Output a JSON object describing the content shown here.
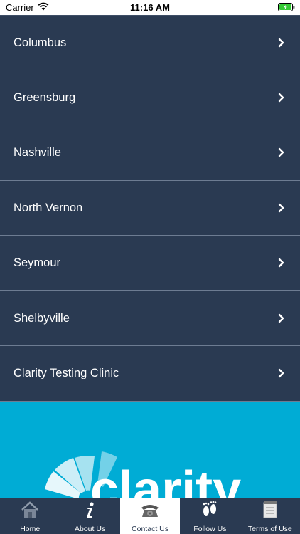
{
  "status_bar": {
    "carrier": "Carrier",
    "time": "11:16 AM"
  },
  "locations": [
    {
      "label": "Columbus"
    },
    {
      "label": "Greensburg"
    },
    {
      "label": "Nashville"
    },
    {
      "label": "North Vernon"
    },
    {
      "label": "Seymour"
    },
    {
      "label": "Shelbyville"
    },
    {
      "label": "Clarity Testing Clinic"
    }
  ],
  "banner": {
    "logo_text": "clarity",
    "color": "#00acd5"
  },
  "tabbar": {
    "active_tab": "Contact Us",
    "tabs": [
      {
        "label": "Home",
        "icon": "home-icon"
      },
      {
        "label": "About Us",
        "icon": "info-icon"
      },
      {
        "label": "Contact Us",
        "icon": "telephone-icon"
      },
      {
        "label": "Follow Us",
        "icon": "footprints-icon"
      },
      {
        "label": "Terms of Use",
        "icon": "notepad-icon"
      }
    ]
  },
  "colors": {
    "list_bg": "#2a3a52",
    "divider": "#6d7c92",
    "accent": "#00acd5"
  }
}
